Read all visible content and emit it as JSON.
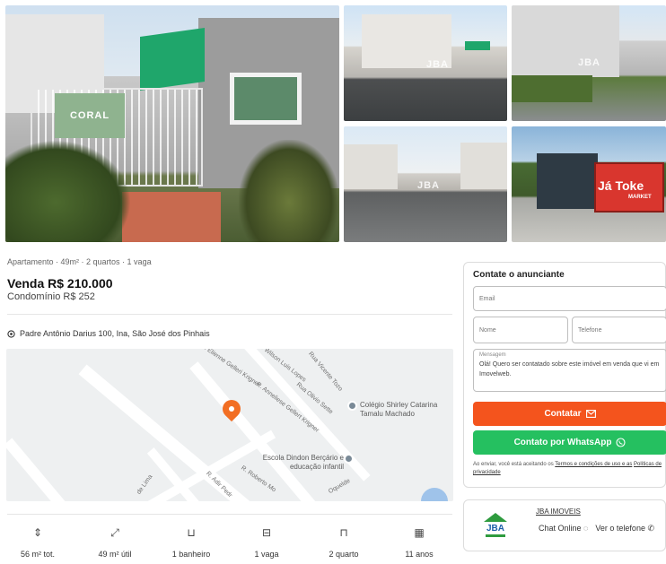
{
  "gallery": {
    "main_sign": "CORAL",
    "watermark": "JBA",
    "container_text": "Já Toke",
    "container_subtext": "MARKET"
  },
  "listing": {
    "summary": "Apartamento · 49m² · 2 quartos · 1 vaga",
    "price": "Venda R$ 210.000",
    "condo": "Condomínio R$ 252",
    "address": "Padre Antônio Darius 100, Ina, São José dos Pinhais"
  },
  "map": {
    "streets": [
      "R. Wilson Luis Lopes",
      "Rua Vicente Tozo",
      "R. Elienne Gelleri Krigner",
      "R. Anneliese Gellert Krigner",
      "Rua Olivio Sette",
      "R. Roberto Mo",
      "R. Adir Pedr",
      "de Lima",
      "Oquelde"
    ],
    "poi_1": "Colégio Shirley Catarina Tamalu Machado",
    "poi_2": "Escola Dindon Berçário e educação infantil"
  },
  "features": [
    {
      "icon": "area-total-icon",
      "glyph": "⇕",
      "label": "56 m² tot."
    },
    {
      "icon": "area-useful-icon",
      "glyph": "⤢",
      "label": "49 m² útil"
    },
    {
      "icon": "bathroom-icon",
      "glyph": "⊔",
      "label": "1 banheiro"
    },
    {
      "icon": "car-icon",
      "glyph": "⊟",
      "label": "1 vaga"
    },
    {
      "icon": "bed-icon",
      "glyph": "⊓",
      "label": "2 quarto"
    },
    {
      "icon": "calendar-icon",
      "glyph": "▦",
      "label": "11 anos"
    }
  ],
  "contact": {
    "title": "Contate o anunciante",
    "email_placeholder": "Email",
    "name_placeholder": "Nome",
    "phone_placeholder": "Telefone",
    "message_label": "Mensagem",
    "message_value": "Olá! Quero ser contatado sobre este imóvel em venda que vi em Imovelweb.",
    "contact_button": "Contatar",
    "whatsapp_button": "Contato por WhatsApp",
    "disclaimer_prefix": "Ao enviar, você está aceitando os",
    "terms_link": "Termos e condições de uso e as",
    "privacy_link": "Políticas de privacidade"
  },
  "agency": {
    "name": "JBA IMOVEIS",
    "chat": "Chat Online",
    "phone": "Ver o telefone",
    "logo_text": "JBA"
  },
  "colors": {
    "accent_orange": "#f4541d",
    "whatsapp_green": "#25c060",
    "pin_orange": "#f26e23"
  }
}
